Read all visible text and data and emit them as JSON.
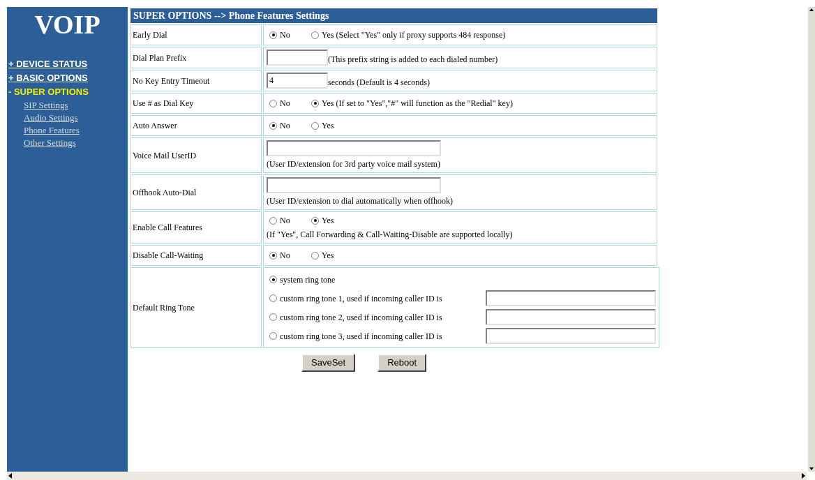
{
  "sidebar": {
    "logo": "VOIP",
    "items": [
      {
        "label": "+ DEVICE STATUS",
        "kind": "section",
        "selected": false
      },
      {
        "label": "+ BASIC OPTIONS",
        "kind": "section",
        "selected": false
      },
      {
        "label": "- SUPER OPTIONS",
        "kind": "section",
        "selected": true
      },
      {
        "label": "SIP Settings",
        "kind": "link",
        "selected": false
      },
      {
        "label": "Audio Settings",
        "kind": "link",
        "selected": false
      },
      {
        "label": "Phone Features",
        "kind": "link",
        "selected": false
      },
      {
        "label": "Other Settings",
        "kind": "link",
        "selected": false
      }
    ]
  },
  "form": {
    "title": "SUPER OPTIONS --> Phone Features Settings",
    "rows": [
      {
        "label": "Early Dial",
        "kind": "radio",
        "options": [
          {
            "label": "No",
            "selected": true
          },
          {
            "label": "Yes (Select \"Yes\" only if proxy supports 484 response)",
            "selected": false
          }
        ]
      },
      {
        "label": "Dial Plan Prefix",
        "kind": "input",
        "note": "(This prefix string is added to each dialed number)"
      },
      {
        "label": "No Key Entry Timeout",
        "kind": "input",
        "value": "4",
        "note": "seconds (Default is 4 seconds)"
      },
      {
        "label": "Use # as Dial Key",
        "kind": "radio",
        "options": [
          {
            "label": "No",
            "selected": false
          },
          {
            "label": "Yes (If set to \"Yes\",\"#\" will function as the \"Redial\" key)",
            "selected": true
          }
        ]
      },
      {
        "label": "Auto Answer",
        "kind": "radio",
        "options": [
          {
            "label": "No",
            "selected": true
          },
          {
            "label": "Yes",
            "selected": false
          }
        ]
      },
      {
        "label": "Voice Mail UserID",
        "kind": "input_below",
        "note": "(User ID/extension for 3rd party voice mail system)"
      },
      {
        "label": "Offhook Auto-Dial",
        "kind": "input_below",
        "note": "(User ID/extension to dial automatically when offhook)"
      },
      {
        "label": "Enable Call Features",
        "kind": "radio_below",
        "options": [
          {
            "label": "No",
            "selected": false
          },
          {
            "label": "Yes",
            "selected": true
          }
        ],
        "note": "(If \"Yes\", Call Forwarding & Call-Waiting-Disable are supported locally)"
      },
      {
        "label": "Disable Call-Waiting",
        "kind": "radio",
        "options": [
          {
            "label": "No",
            "selected": true
          },
          {
            "label": "Yes",
            "selected": false
          }
        ]
      },
      {
        "label": "Default Ring Tone",
        "kind": "ringtone",
        "options": [
          {
            "label": "system ring tone",
            "selected": true,
            "kind": "plain"
          },
          {
            "label": "custom ring tone 1, used if incoming caller ID is",
            "selected": false,
            "kind": "with_field"
          },
          {
            "label": "custom ring tone 2, used if incoming caller ID is",
            "selected": false,
            "kind": "with_field"
          },
          {
            "label": "custom ring tone 3, used if incoming caller ID is",
            "selected": false,
            "kind": "with_field"
          }
        ]
      }
    ],
    "buttons": [
      "SaveSet",
      "Reboot"
    ]
  }
}
